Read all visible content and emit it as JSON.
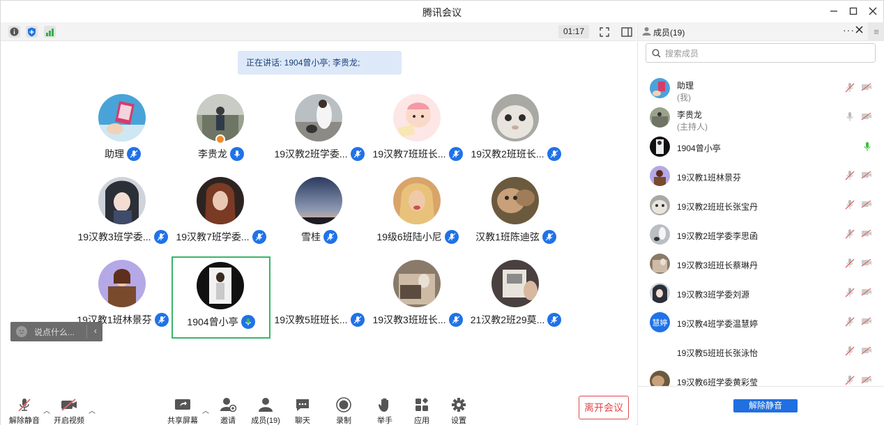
{
  "window": {
    "title": "腾讯会议"
  },
  "toolbar": {
    "timer": "01:17"
  },
  "main": {
    "speaking": "正在讲话: 1904曾小亭; 李贵龙;",
    "tiles": [
      {
        "name": "助理"
      },
      {
        "name": "李贵龙"
      },
      {
        "name": "19汉教2班学委..."
      },
      {
        "name": "19汉教7班班长..."
      },
      {
        "name": "19汉教2班班长..."
      },
      {
        "name": "19汉教3班学委..."
      },
      {
        "name": "19汉教7班学委..."
      },
      {
        "name": "雪桂"
      },
      {
        "name": "19级6班陆小尼"
      },
      {
        "name": "汉教1班陈迪弦"
      },
      {
        "name": "19汉教1班林景芬"
      },
      {
        "name": "1904曾小亭"
      },
      {
        "name": "19汉教5班班长..."
      },
      {
        "name": "19汉教3班班长..."
      },
      {
        "name": "21汉教2班29莫..."
      }
    ],
    "chat_placeholder": "说点什么..."
  },
  "bottom": {
    "unmute": "解除静音",
    "start_video": "开启视频",
    "share_screen": "共享屏幕",
    "invite": "邀请",
    "members": "成员(19)",
    "chat": "聊天",
    "record": "录制",
    "raise_hand": "举手",
    "apps": "应用",
    "settings": "设置",
    "leave": "离开会议"
  },
  "side": {
    "title": "成员(19)",
    "search_placeholder": "搜索成员",
    "members": [
      {
        "name": "助理",
        "role": "(我)"
      },
      {
        "name": "李贵龙",
        "role": "(主持人)"
      },
      {
        "name": "1904曾小亭",
        "role": ""
      },
      {
        "name": "19汉教1班林景芬",
        "role": ""
      },
      {
        "name": "19汉教2班班长张宝丹",
        "role": ""
      },
      {
        "name": "19汉教2班学委李思函",
        "role": ""
      },
      {
        "name": "19汉教3班班长蔡琳丹",
        "role": ""
      },
      {
        "name": "19汉教3班学委刘源",
        "role": ""
      },
      {
        "name": "19汉教4班学委温慧婷",
        "role": "",
        "avatar_text": "慧婷"
      },
      {
        "name": "19汉教5班班长张泳怡",
        "role": ""
      },
      {
        "name": "19汉教6班学委黄彩莹",
        "role": ""
      }
    ],
    "unmute_all": "解除静音"
  },
  "colors": {
    "accent": "#1f72e8",
    "active_border": "#3ab56c",
    "leave": "#e44848",
    "mic_active": "#3cbf3c",
    "muted": "#e06a6a"
  }
}
